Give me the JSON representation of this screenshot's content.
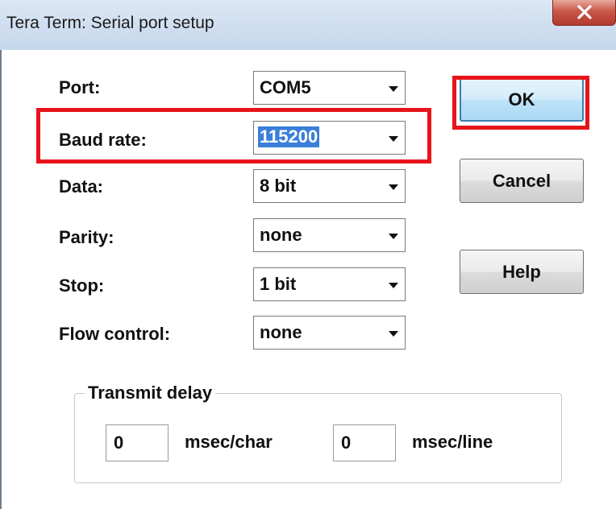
{
  "window": {
    "title": "Tera Term: Serial port setup",
    "close_glyph": "✕"
  },
  "fields": [
    {
      "label": "Port:",
      "value": "COM5"
    },
    {
      "label": "Baud rate:",
      "value": "115200",
      "selected": true
    },
    {
      "label": "Data:",
      "value": "8 bit"
    },
    {
      "label": "Parity:",
      "value": "none"
    },
    {
      "label": "Stop:",
      "value": "1 bit"
    },
    {
      "label": "Flow control:",
      "value": "none"
    }
  ],
  "buttons": {
    "ok": "OK",
    "cancel": "Cancel",
    "help": "Help"
  },
  "transmit_delay": {
    "title": "Transmit delay",
    "char_value": "0",
    "char_unit": "msec/char",
    "line_value": "0",
    "line_unit": "msec/line"
  },
  "colors": {
    "highlight": "#e8141b",
    "selection": "#3a7fd9",
    "close_button": "#c9574a"
  },
  "icons": {
    "close": "close-icon",
    "dropdown": "chevron-down-icon"
  }
}
